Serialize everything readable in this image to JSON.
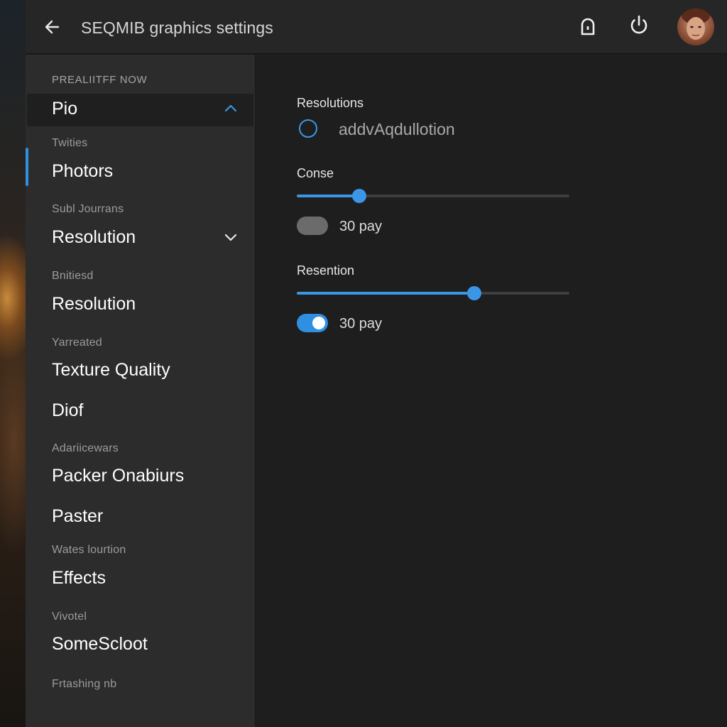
{
  "header": {
    "title": "SEQMIB graphics settings",
    "back_icon": "arrow-left-icon",
    "lock_icon": "lock-icon",
    "power_icon": "power-icon",
    "avatar": "user-avatar"
  },
  "sidebar": {
    "caption": "PREALIITFF NOW",
    "active_item": "Pio",
    "groups": [
      {
        "section": "Twities",
        "item": "Photors"
      },
      {
        "section": "Subl Jourrans",
        "item": "Resolution"
      },
      {
        "section": "Bnitiesd",
        "item": "Resolution"
      },
      {
        "section": "Yarreated",
        "item": "Texture Quality"
      },
      {
        "section": "",
        "item": "Diof"
      },
      {
        "section": "Adariicewars",
        "item": "Packer Onabiurs"
      },
      {
        "section": "",
        "item": "Paster"
      },
      {
        "section": "Wates lourtion",
        "item": "Effects"
      },
      {
        "section": "Vivotel",
        "item": "SomeScloot"
      },
      {
        "section": "Frtashing nb",
        "item": ""
      }
    ]
  },
  "main": {
    "resolutions_label": "Resolutions",
    "radio_label": "addvAqdullotion",
    "conse_label": "Conse",
    "conse_value": 0.23,
    "toggle1_label": "30 pay",
    "toggle1_on": false,
    "resention_label": "Resention",
    "resention_value": 0.65,
    "toggle2_label": "30 pay",
    "toggle2_on": true
  },
  "colors": {
    "accent": "#3a96e6",
    "background": "#1e1e1f",
    "sidebar": "#2c2c2d",
    "header": "#262627"
  }
}
